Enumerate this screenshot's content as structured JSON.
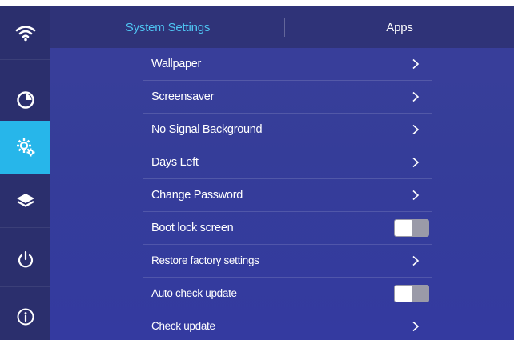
{
  "sidebar": {
    "items": [
      {
        "name": "wifi",
        "icon": "wifi-icon",
        "active": false
      },
      {
        "name": "clock",
        "icon": "clock-icon",
        "active": false
      },
      {
        "name": "settings",
        "icon": "gear-icon",
        "active": true
      },
      {
        "name": "layers",
        "icon": "layers-icon",
        "active": false
      },
      {
        "name": "power",
        "icon": "power-icon",
        "active": false
      },
      {
        "name": "info",
        "icon": "info-icon",
        "active": false
      }
    ]
  },
  "header": {
    "tabs": [
      {
        "label": "System Settings",
        "active": true
      },
      {
        "label": "Apps",
        "active": false
      }
    ]
  },
  "menu": {
    "items": [
      {
        "label": "Wallpaper",
        "control": "chevron"
      },
      {
        "label": "Screensaver",
        "control": "chevron"
      },
      {
        "label": "No Signal Background",
        "control": "chevron"
      },
      {
        "label": "Days Left",
        "control": "chevron"
      },
      {
        "label": "Change Password",
        "control": "chevron"
      },
      {
        "label": "Boot lock screen",
        "control": "toggle",
        "on": false
      },
      {
        "label": "Restore factory settings",
        "control": "chevron"
      },
      {
        "label": "Auto check update",
        "control": "toggle",
        "on": false
      },
      {
        "label": "Check update",
        "control": "chevron"
      }
    ]
  },
  "colors": {
    "accent": "#27b6ea",
    "active_tab_text": "#4fc5f3",
    "sidebar_bg": "#2b2f6d",
    "background": "#3a3f9a"
  }
}
